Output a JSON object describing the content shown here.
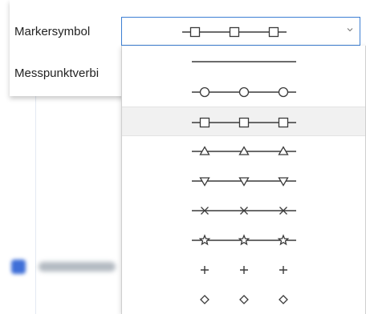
{
  "panel": {
    "marker_label": "Markersymbol",
    "line_label": "Messpunktverbi"
  },
  "combo": {
    "selected": "square"
  },
  "dropdown": {
    "hover_index": 2,
    "options": [
      {
        "symbol": "none"
      },
      {
        "symbol": "circle"
      },
      {
        "symbol": "square"
      },
      {
        "symbol": "triangle-up"
      },
      {
        "symbol": "triangle-down"
      },
      {
        "symbol": "x"
      },
      {
        "symbol": "star"
      },
      {
        "symbol": "plus"
      },
      {
        "symbol": "diamond"
      }
    ]
  },
  "colors": {
    "accent": "#3c7fd3",
    "hover": "#f1f1f1",
    "stroke": "#3a3a3a"
  }
}
